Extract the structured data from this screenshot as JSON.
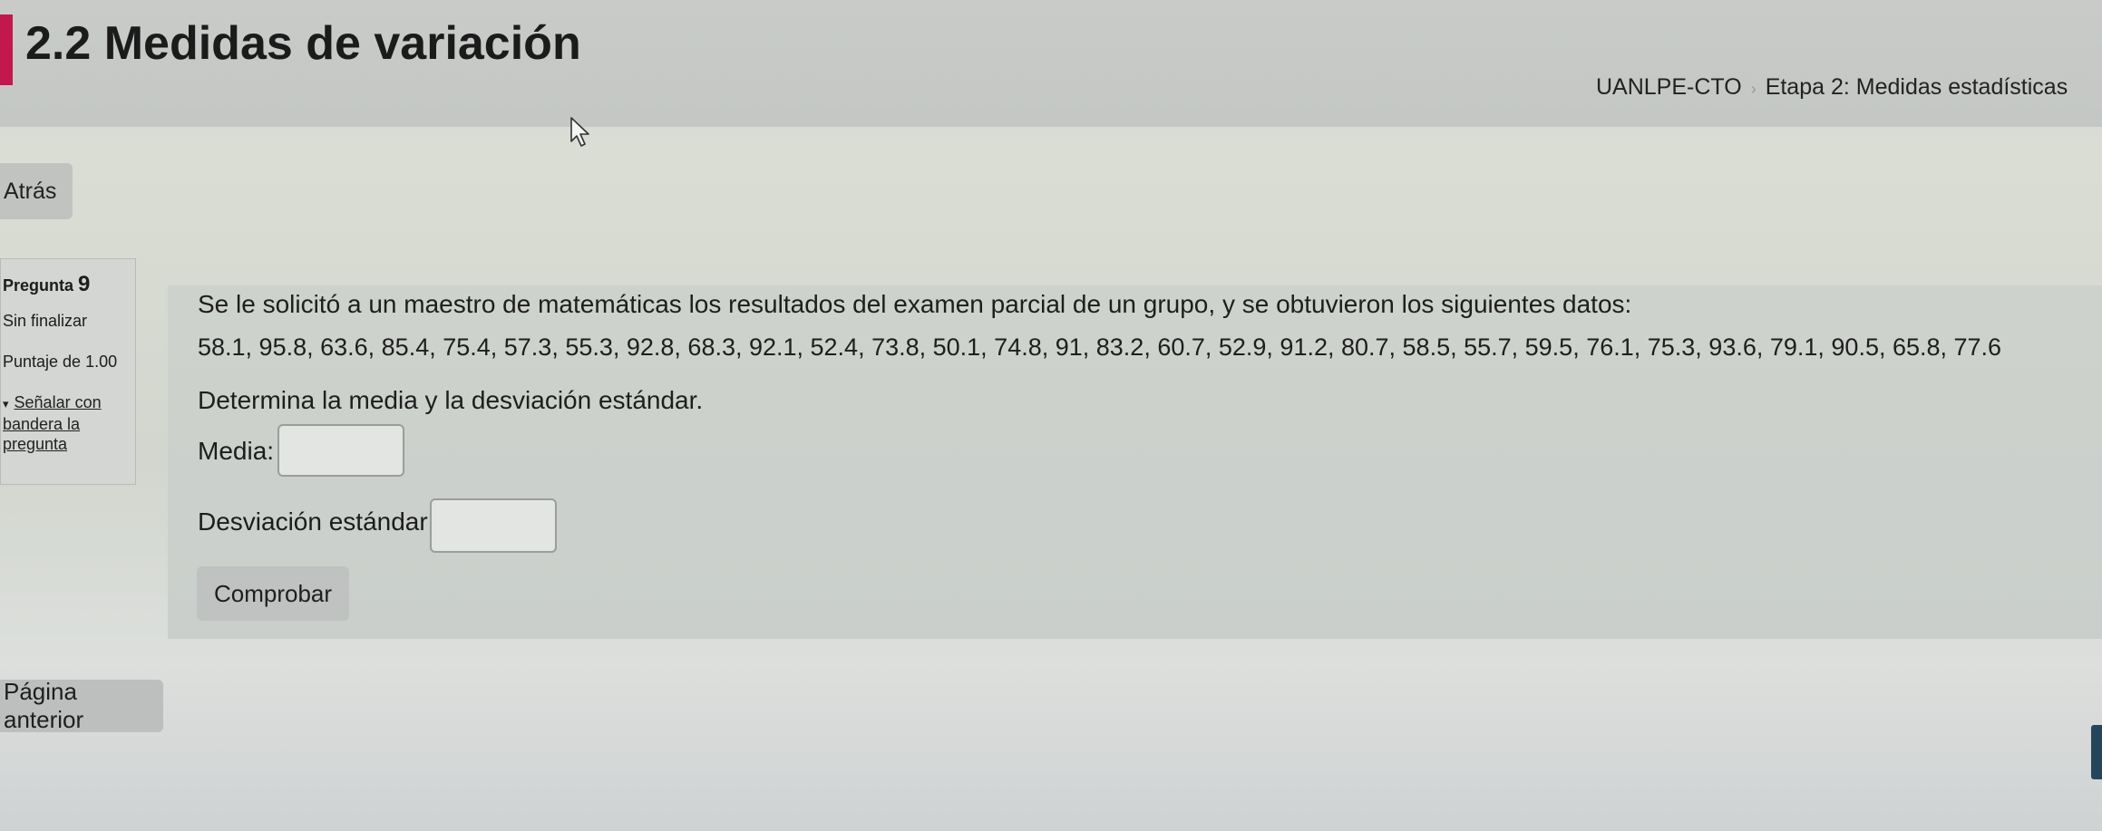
{
  "header": {
    "title": "2.2 Medidas de variación",
    "breadcrumb": [
      "UANLPE-CTO",
      "Etapa 2: Medidas estadísticas"
    ],
    "accent_color": "#c2184d"
  },
  "nav": {
    "back_label": "Atrás",
    "prev_page_label": "Página anterior"
  },
  "question_info": {
    "label": "Pregunta",
    "number": "9",
    "state": "Sin finalizar",
    "grade": "Puntaje de 1.00",
    "flag_line1": "Señalar con",
    "flag_line2": "bandera la",
    "flag_line3": "pregunta"
  },
  "question": {
    "text": "Se le solicitó a un maestro de matemáticas los resultados del examen parcial de un grupo, y se obtuvieron los siguientes datos:",
    "data": "58.1, 95.8, 63.6, 85.4, 75.4, 57.3, 55.3, 92.8, 68.3, 92.1, 52.4, 73.8, 50.1, 74.8, 91, 83.2, 60.7, 52.9, 91.2, 80.7, 58.5, 55.7, 59.5, 76.1, 75.3, 93.6, 79.1, 90.5, 65.8, 77.6",
    "instruction": "Determina la media y la desviación estándar.",
    "mean_label": "Media:",
    "mean_value": "",
    "sd_label": "Desviación estándar:",
    "sd_value": "",
    "check_label": "Comprobar"
  },
  "icons": {
    "cursor": "mouse-pointer-icon",
    "flag": "flag-icon",
    "breadcrumb_separator": "chevron-right-icon"
  }
}
